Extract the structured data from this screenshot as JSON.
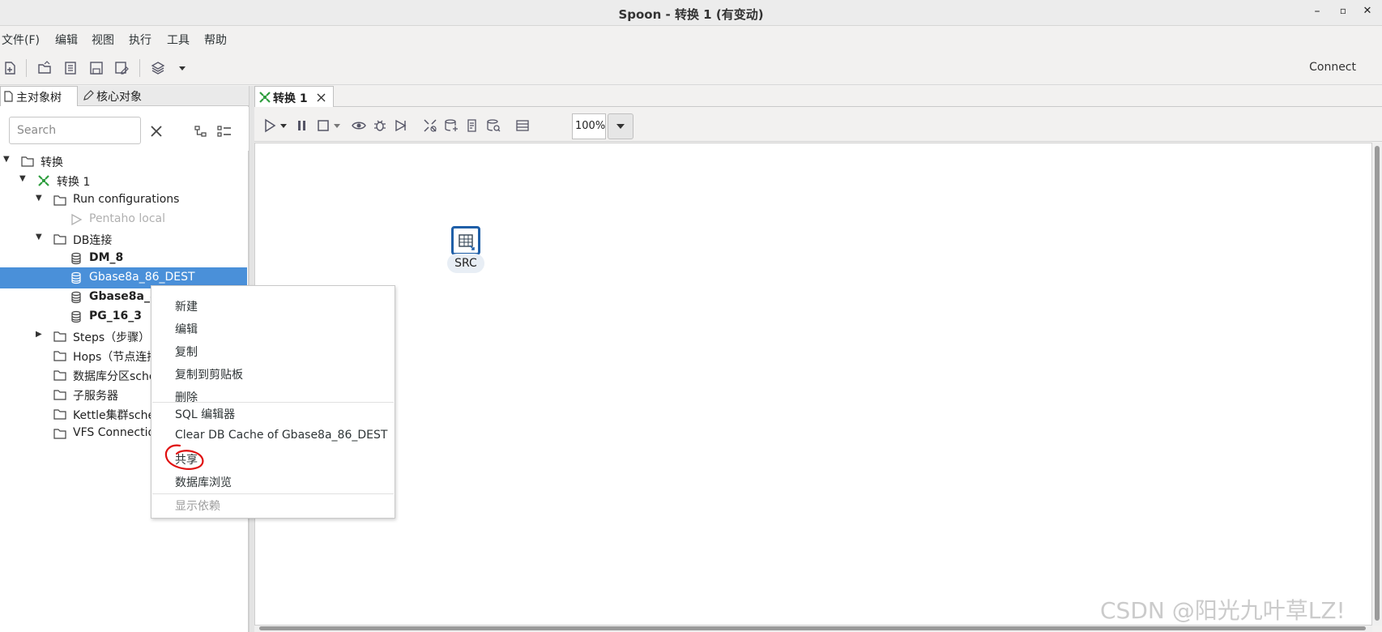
{
  "window": {
    "title": "Spoon - 转换 1 (有变动)",
    "minimize": "–",
    "maximize": "▫",
    "close": "✕"
  },
  "menubar": {
    "items": [
      "文件(F)",
      "编辑",
      "视图",
      "执行",
      "工具",
      "帮助"
    ]
  },
  "toolbar": {
    "connect_label": "Connect"
  },
  "left_panel": {
    "tabs": [
      "主对象树",
      "核心对象"
    ],
    "search_placeholder": "Search",
    "tree": {
      "root": "转换",
      "transformation": "转换 1",
      "run_configurations": "Run configurations",
      "pentaho_local": "Pentaho local",
      "db_folder": "DB连接",
      "db_items": [
        "DM_8",
        "Gbase8a_86_DEST",
        "Gbase8a_86",
        "PG_16_3"
      ],
      "steps": "Steps（步骤）",
      "hops": "Hops（节点连接）",
      "partition": "数据库分区schemas",
      "subservers": "子服务器",
      "kettle_cluster": "Kettle集群schemas",
      "vfs": "VFS Connections"
    }
  },
  "editor": {
    "tab_label": "转换 1",
    "zoom_value": "100%",
    "step_label": "SRC"
  },
  "context_menu": {
    "items": [
      "新建",
      "编辑",
      "复制",
      "复制到剪贴板",
      "删除",
      "SQL 编辑器",
      "Clear DB Cache of Gbase8a_86_DEST",
      "共享",
      "数据库浏览",
      "显示依赖"
    ]
  },
  "colors": {
    "selection": "#4a90d9",
    "annotation_circle": "#e01010",
    "step_border": "#1f5fa8",
    "transform_icon": "#2e9e3e"
  },
  "watermark": "CSDN @阳光九叶草LZ!"
}
